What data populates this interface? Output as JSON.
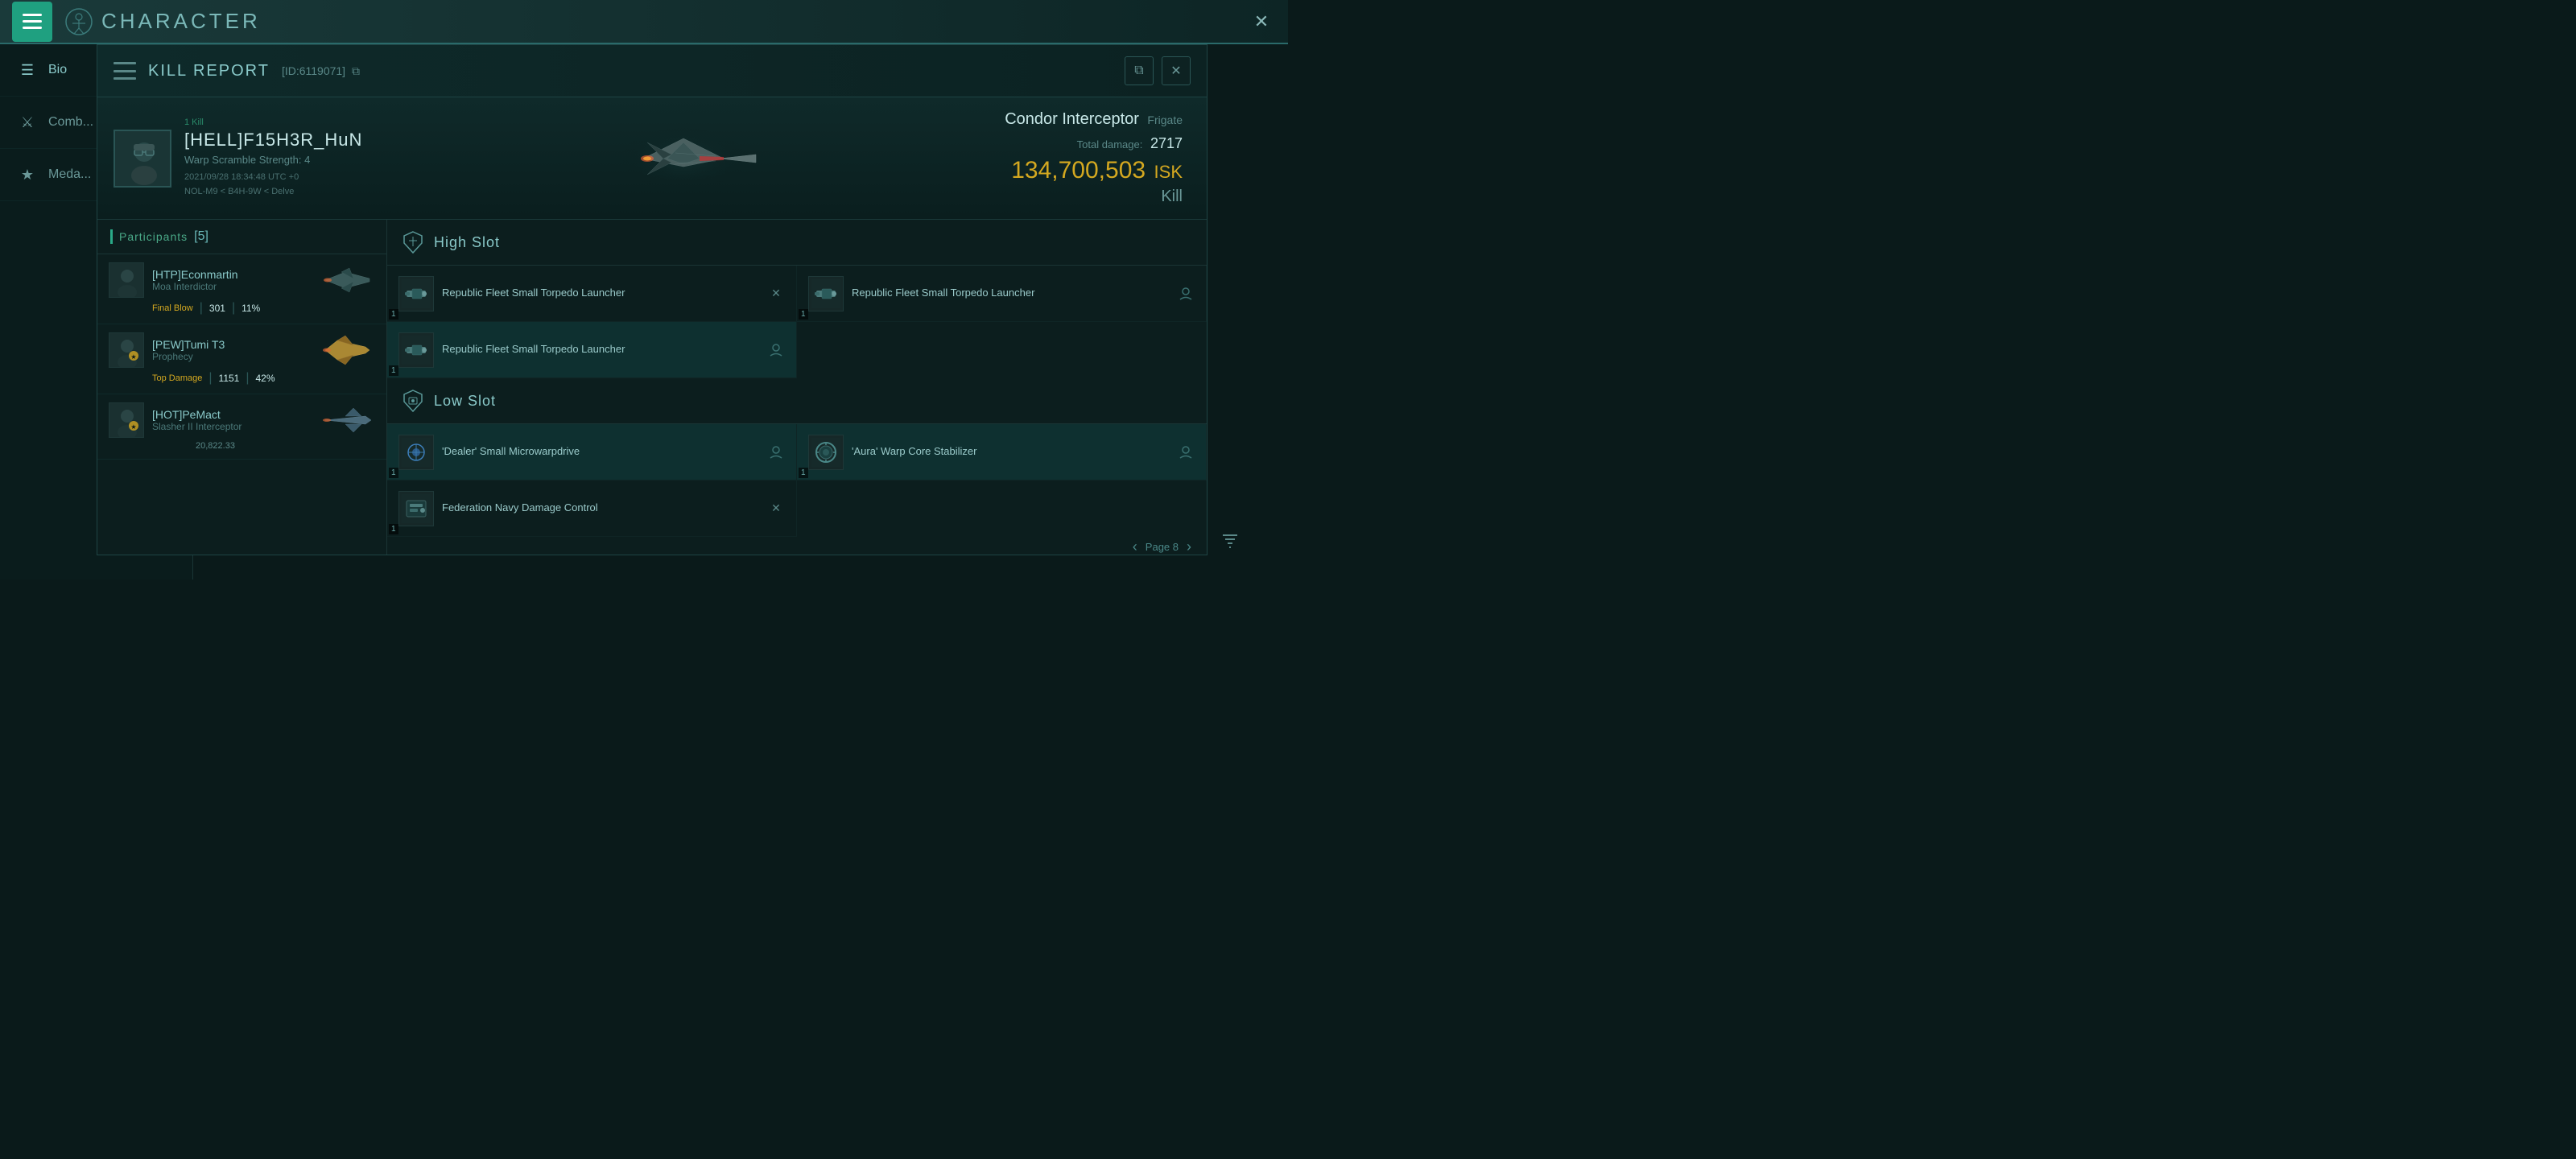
{
  "app": {
    "title": "CHARACTER",
    "close_label": "✕"
  },
  "topbar": {
    "icon": "☰",
    "title": "CHARACTER"
  },
  "sidebar": {
    "items": [
      {
        "id": "bio",
        "label": "Bio",
        "icon": "☰"
      },
      {
        "id": "combat",
        "label": "Comb...",
        "icon": "⚔"
      },
      {
        "id": "medals",
        "label": "Meda...",
        "icon": "★"
      }
    ]
  },
  "kill_report": {
    "title": "KILL REPORT",
    "id": "[ID:6119071]",
    "id_copy_icon": "⧉",
    "pilot": {
      "name": "[HELL]F15H3R_HuN",
      "warp_scramble": "Warp Scramble Strength: 4",
      "kill_count": "1 Kill",
      "timestamp": "2021/09/28 18:34:48 UTC +0",
      "location": "NOL-M9 < B4H-9W < Delve"
    },
    "ship": {
      "type": "Condor Interceptor",
      "class": "Frigate",
      "total_damage_label": "Total damage:",
      "total_damage": "2717",
      "isk_value": "134,700,503",
      "isk_label": "ISK",
      "kill_label": "Kill"
    },
    "participants": {
      "title": "Participants",
      "count": "[5]",
      "items": [
        {
          "name": "[HTP]Econmartin",
          "ship": "Moa Interdictor",
          "badge": "Final Blow",
          "damage": "301",
          "percent": "11%",
          "has_star": false
        },
        {
          "name": "[PEW]Tumi T3",
          "ship": "Prophecy",
          "badge": "Top Damage",
          "damage": "1151",
          "percent": "42%",
          "has_star": true
        },
        {
          "name": "[HOT]PeMact",
          "ship": "Slasher II Interceptor",
          "badge": "",
          "damage": "20,822.33",
          "percent": "",
          "has_star": true
        }
      ]
    },
    "slots": {
      "high_slot": {
        "title": "High Slot",
        "items": [
          {
            "name": "Republic Fleet Small Torpedo Launcher",
            "qty": "1",
            "highlighted": false,
            "status": "x",
            "col": 0
          },
          {
            "name": "Republic Fleet Small Torpedo Launcher",
            "qty": "1",
            "highlighted": false,
            "status": "person",
            "col": 1
          },
          {
            "name": "Republic Fleet Small Torpedo Launcher",
            "qty": "1",
            "highlighted": true,
            "status": "person",
            "col": 0
          }
        ]
      },
      "low_slot": {
        "title": "Low Slot",
        "items": [
          {
            "name": "'Dealer' Small Microwarpdrive",
            "qty": "1",
            "highlighted": true,
            "status": "person",
            "col": 0
          },
          {
            "name": "'Aura' Warp Core Stabilizer",
            "qty": "1",
            "highlighted": true,
            "status": "person",
            "col": 1
          },
          {
            "name": "Federation Navy Damage Control",
            "qty": "1",
            "highlighted": false,
            "status": "x",
            "col": 0
          }
        ]
      }
    }
  },
  "pagination": {
    "label": "Page 8",
    "prev": "‹",
    "next": "›"
  },
  "icons": {
    "hamburger": "☰",
    "close": "✕",
    "export": "⧉",
    "filter": "⊞",
    "chevron_left": "‹",
    "chevron_right": "›",
    "shield": "🛡",
    "x_mark": "✕",
    "person": "👤",
    "star": "★"
  }
}
